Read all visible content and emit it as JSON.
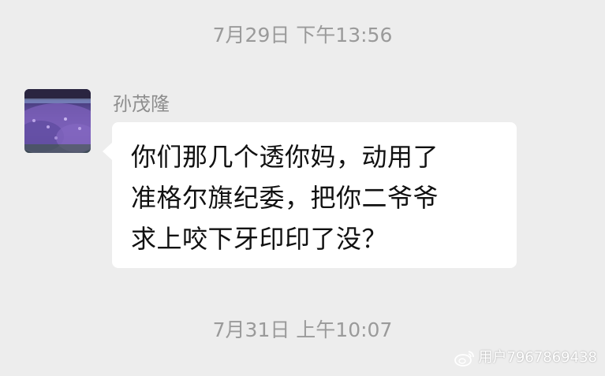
{
  "chat": {
    "messages_timestamps": [
      "7月29日 下午13:56",
      "7月31日 上午10:07"
    ],
    "sender": {
      "name": "孙茂隆",
      "avatar_icon": "lavender-field-avatar"
    },
    "message": {
      "lines": [
        "你们那几个透你妈，动用了",
        "准格尔旗纪委，把你二爷爷",
        "求上咬下牙印印了没？"
      ]
    }
  },
  "watermark": {
    "text": "用户7967869438",
    "logo_icon": "weibo-logo-icon"
  },
  "colors": {
    "background": "#ededed",
    "bubble": "#ffffff",
    "timestamp_text": "#9a9a9a",
    "name_text": "#8d8d8d",
    "message_text": "#111111"
  }
}
